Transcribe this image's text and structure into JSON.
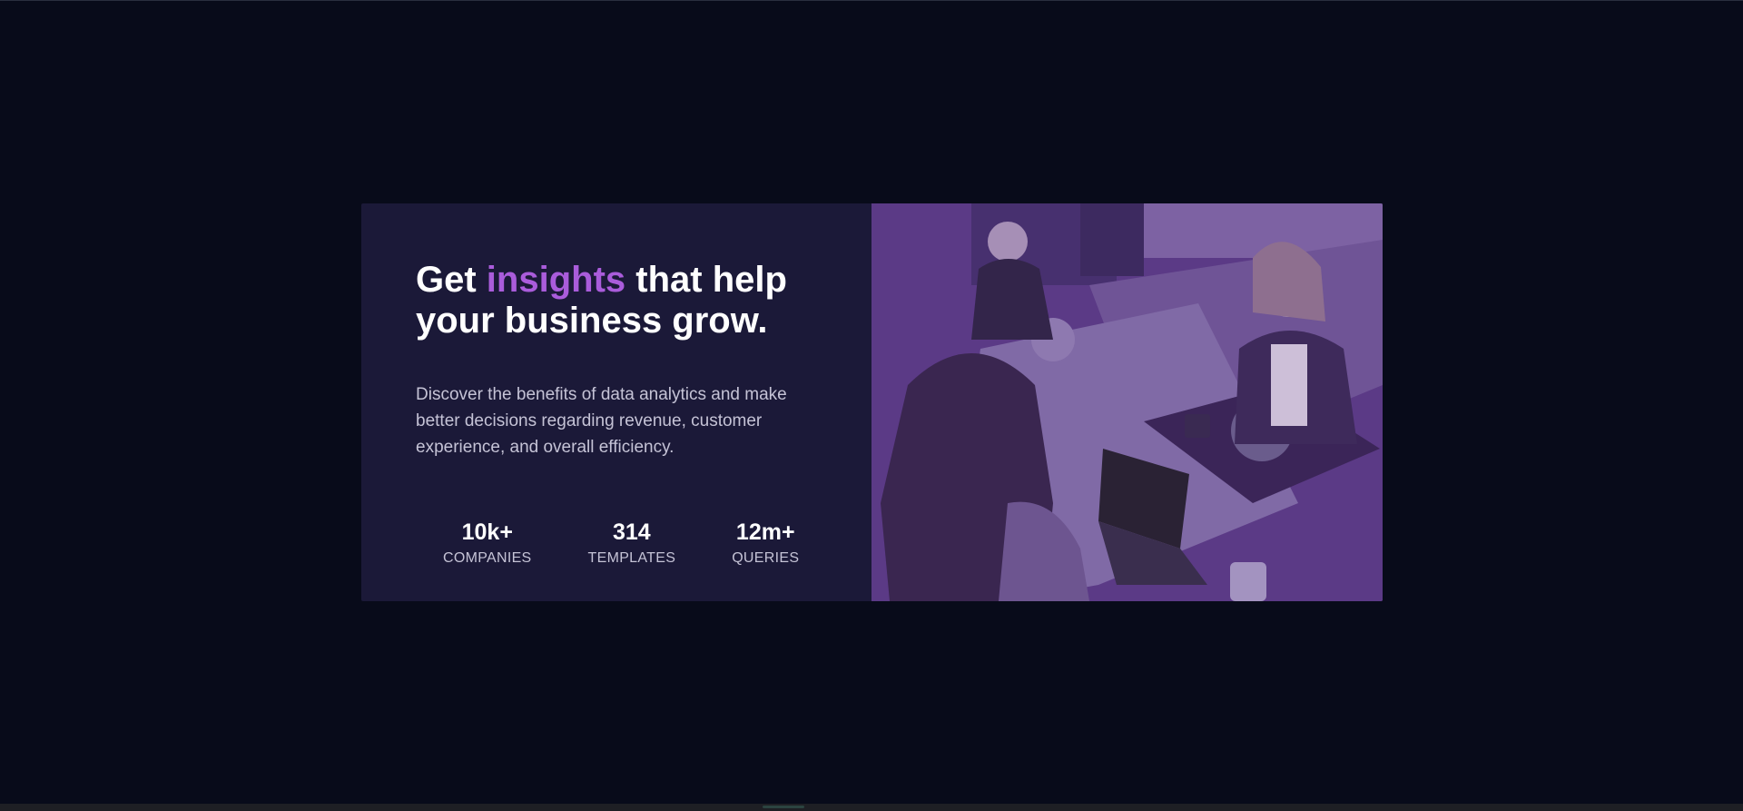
{
  "hero": {
    "title_start": "Get ",
    "title_accent": "insights",
    "title_end": " that help your business grow.",
    "description": "Discover the benefits of data analytics and make better decisions regarding revenue, customer experience, and overall efficiency."
  },
  "stats": [
    {
      "value": "10k+",
      "label": "COMPANIES"
    },
    {
      "value": "314",
      "label": "TEMPLATES"
    },
    {
      "value": "12m+",
      "label": "QUERIES"
    }
  ],
  "image": {
    "icon": "office-team-photo",
    "tint": "#5b3a86"
  },
  "colors": {
    "page_background": "#080b1a",
    "card_background": "#1b1938",
    "accent": "#aa5cdb",
    "text_muted": "#c5c3d6"
  }
}
